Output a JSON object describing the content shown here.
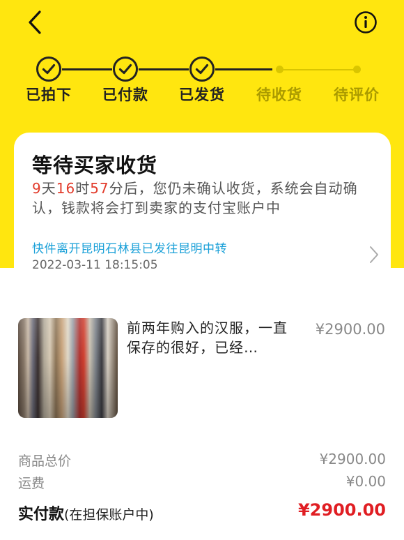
{
  "colors": {
    "header_yellow": "#ffe60f",
    "red_price": "#e01e23",
    "countdown_red": "#e23b2b",
    "link_blue": "#1aa0d8"
  },
  "icons": {
    "back": "chevron-left-icon",
    "info": "info-circle-icon",
    "done_step": "check-circle-icon",
    "track": "chevron-right-icon"
  },
  "progress": {
    "steps": [
      {
        "label": "已拍下",
        "state": "done"
      },
      {
        "label": "已付款",
        "state": "done"
      },
      {
        "label": "已发货",
        "state": "done"
      },
      {
        "label": "待收货",
        "state": "pending"
      },
      {
        "label": "待评价",
        "state": "pending"
      }
    ]
  },
  "status": {
    "title": "等待买家收货",
    "days": "9",
    "days_unit": "天",
    "hours": "16",
    "hours_unit": "时",
    "minutes": "57",
    "message": "分后，您仍未确认收货，系统会自动确认，钱款将会打到卖家的支付宝账户中",
    "tracking_text": "快件离开昆明石林县已发往昆明中转",
    "tracking_time": "2022-03-11 18:15:05"
  },
  "product": {
    "title": "前两年购入的汉服，一直保存的很好，已经…",
    "price": "¥2900.00"
  },
  "summary": {
    "total_label": "商品总价",
    "total_value": "¥2900.00",
    "shipping_label": "运费",
    "shipping_value": "¥0.00",
    "paid_label": "实付款",
    "paid_sub": "(在担保账户中)",
    "paid_value": "¥2900.00"
  }
}
